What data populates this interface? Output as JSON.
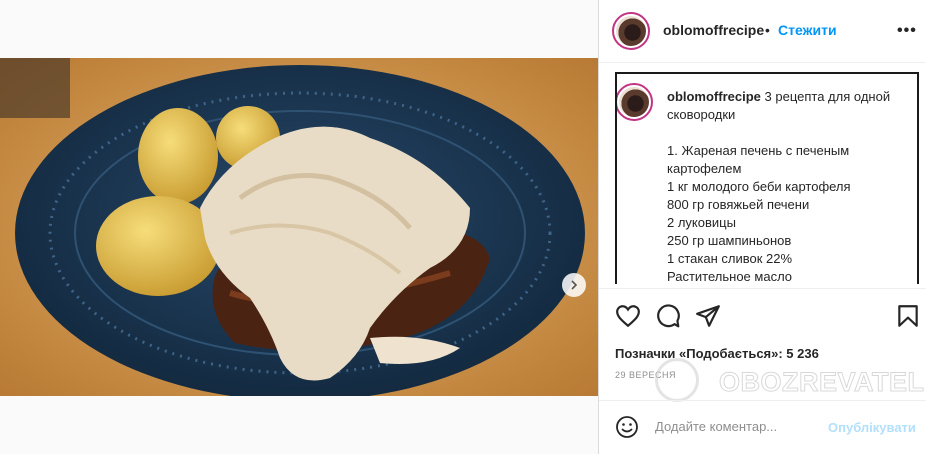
{
  "post": {
    "username": "oblomoffrecipe",
    "separator": "•",
    "follow_label": "Стежити",
    "more_label": "•••",
    "caption": {
      "username": "oblomoffrecipe",
      "lines": [
        "3 рецепта для одной сковородки",
        "",
        "1. Жареная печень с печеным",
        "картофелем",
        "1 кг молодого беби картофеля",
        "800 гр говяжьей печени",
        "2 луковицы",
        "250 гр шампиньонов",
        "1 стакан сливок 22%",
        "Растительное масло"
      ]
    },
    "likes_text": "Позначки «Подобається»: 5 236",
    "date_text": "29 ВЕРЕСНЯ",
    "carousel": {
      "total": 2,
      "active_index": 1
    }
  },
  "comment": {
    "placeholder": "Додайте коментар...",
    "publish_label": "Опублікувати"
  },
  "watermark": {
    "text": "OBOZREVATEL"
  },
  "colors": {
    "link": "#0095f6",
    "publish_disabled": "#b2dffc",
    "plate": "#1d3a55"
  }
}
